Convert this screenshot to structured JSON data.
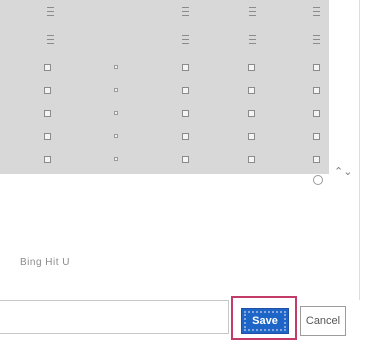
{
  "status": {
    "text": "Bing Hit U"
  },
  "actions": {
    "save_label": "Save",
    "cancel_label": "Cancel"
  },
  "scroll": {
    "arrows": "⌃⌄"
  },
  "colors": {
    "grid_background": "#d8d8d8",
    "save_button": "#1d65c6",
    "focus_ring": "#c33b67"
  }
}
